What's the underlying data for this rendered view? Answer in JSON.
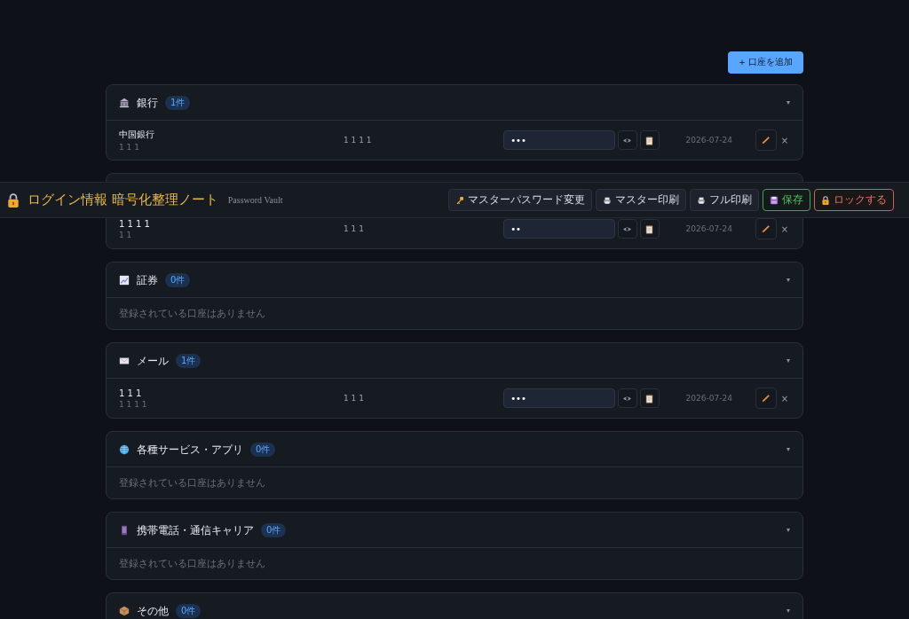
{
  "add_button": "+ 口座を追加",
  "header": {
    "title": "ログイン情報 暗号化整理ノート",
    "subtitle": "Password Vault",
    "buttons": [
      {
        "kind": "key",
        "label": "マスターパスワード変更"
      },
      {
        "kind": "printer",
        "label": "マスター印刷"
      },
      {
        "kind": "printer",
        "label": "フル印刷"
      },
      {
        "kind": "save",
        "label": "保存"
      },
      {
        "kind": "lock",
        "label": "ロックする"
      }
    ]
  },
  "categories": [
    {
      "kind": "bank",
      "name": "銀行",
      "count": "1件",
      "toggle": "▾",
      "accounts": [
        {
          "name": "中国銀行",
          "sub": "1 1 1",
          "username": "1 1 1 1",
          "password": "•••",
          "date": "2026-07-24",
          "delete": "×"
        }
      ]
    },
    {
      "accounts": [
        {
          "name": "1 1 1 1",
          "sub": "1 1",
          "username": "1 1 1",
          "password": "••",
          "date": "2026-07-24",
          "delete": "×"
        }
      ]
    },
    {
      "kind": "chart",
      "name": "証券",
      "count": "0件",
      "toggle": "▾",
      "empty_text": "登録されている口座はありません"
    },
    {
      "kind": "mail",
      "name": "メール",
      "count": "1件",
      "toggle": "▾",
      "accounts": [
        {
          "name": "1 1 1",
          "sub": "1 1 1 1",
          "username": "1 1 1",
          "password": "•••",
          "date": "2026-07-24",
          "delete": "×"
        }
      ]
    },
    {
      "kind": "globe",
      "name": "各種サービス・アプリ",
      "count": "0件",
      "toggle": "▾",
      "empty_text": "登録されている口座はありません"
    },
    {
      "kind": "phone",
      "name": "携帯電話・通信キャリア",
      "count": "0件",
      "toggle": "▾",
      "empty_text": "登録されている口座はありません"
    },
    {
      "kind": "package",
      "name": "その他",
      "count": "0件",
      "toggle": "▾"
    }
  ]
}
